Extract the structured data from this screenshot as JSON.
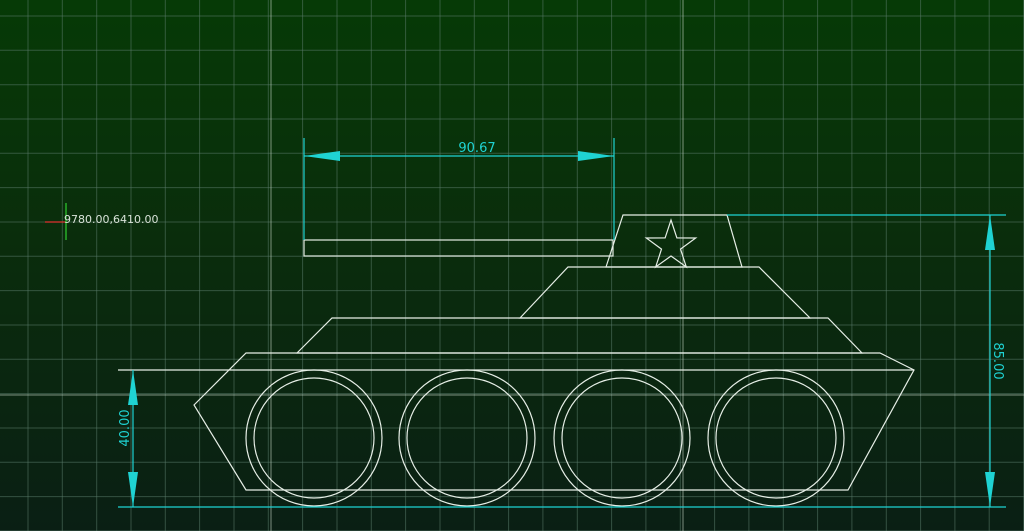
{
  "viewport": {
    "coordinate_readout": "9780.00,6410.00"
  },
  "dimensions": {
    "gun_length": "90.67",
    "total_height": "85.00",
    "wheel_height": "40.00"
  },
  "colors": {
    "dimension": "#1fd3d3",
    "geometry": "#e6eee6",
    "grid": "#5a7a6a",
    "background_top": "#063a06",
    "background_bottom": "#0a1f14"
  },
  "icons": {
    "cursor": "crosshair-cursor-icon",
    "emblem": "star-icon"
  }
}
